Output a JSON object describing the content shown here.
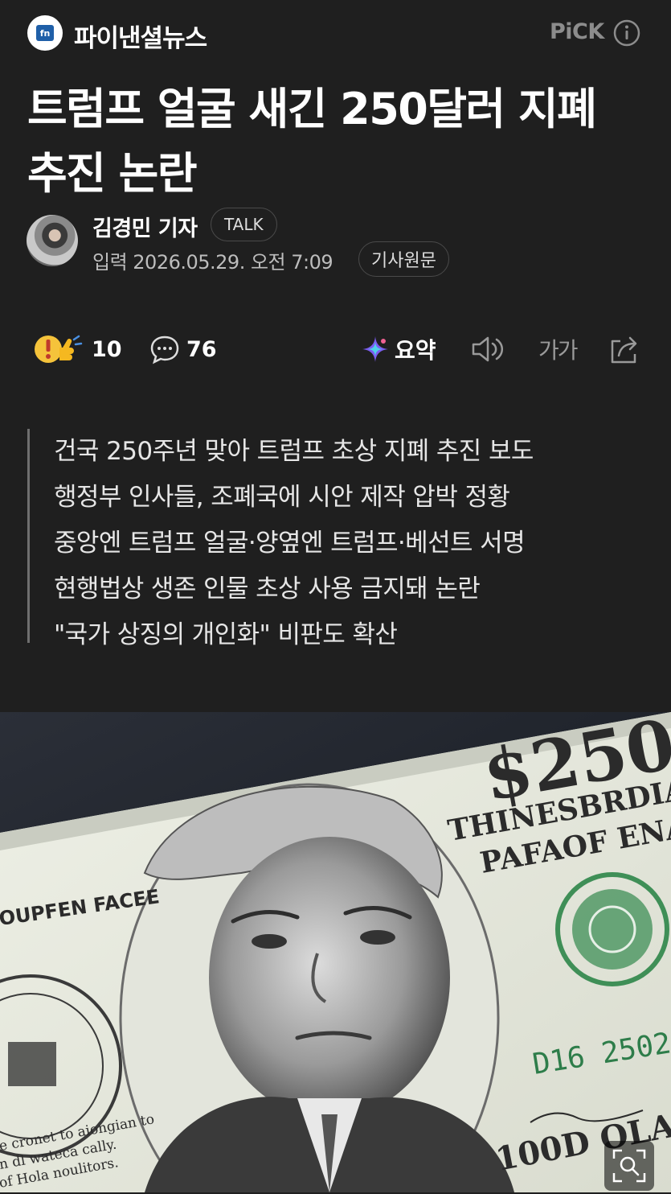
{
  "header": {
    "press_name": "파이낸셜뉴스",
    "press_logo_text": "fn",
    "pick_label": "PiCK"
  },
  "article": {
    "title": "트럼프 얼굴 새긴 250달러 지폐 추진 논란",
    "reporter": "김경민 기자",
    "talk_label": "TALK",
    "date": "입력 2026.05.29. 오전 7:09",
    "original_label": "기사원문"
  },
  "toolbar": {
    "reaction_count": "10",
    "comment_count": "76",
    "summary_label": "요약",
    "font_size_label": "가가"
  },
  "summary": {
    "lines": [
      "건국 250주년 맞아 트럼프 초상 지폐 추진 보도",
      "행정부 인사들, 조폐국에 시안 제작 압박 정황",
      "중앙엔 트럼프 얼굴·양옆엔 트럼프·베선트 서명",
      "현행법상 생존 인물 초상 사용 금지돼 논란",
      "\"국가 상징의 개인화\" 비판도 확산"
    ]
  },
  "photo": {
    "note_value": "$250",
    "note_text_1": "THINESBRDIAT",
    "note_text_2": "PAFAOF ENA",
    "note_left_text": "OUPFEN FACEE",
    "serial": "D16 2502",
    "bottom_value": "100D OLA",
    "fine_print_1": "e cronet to aiongian to",
    "fine_print_2": "n dl wateca cally.",
    "fine_print_3": "of Hola noulitors."
  },
  "colors": {
    "background": "#1f1f1f",
    "text": "#ffffff",
    "muted": "#bdbdbd",
    "border": "#4a4a4a",
    "note_green": "#3f8f57"
  },
  "icons": [
    "info-icon",
    "reaction-icon",
    "comment-icon",
    "ai-summary-icon",
    "speaker-icon",
    "share-icon",
    "zoom-icon"
  ]
}
